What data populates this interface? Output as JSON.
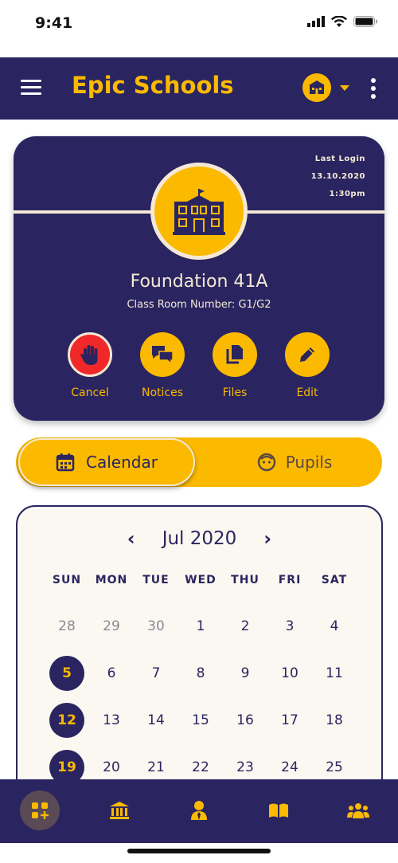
{
  "status": {
    "time": "9:41"
  },
  "header": {
    "app_name": "Epic Schools"
  },
  "class_card": {
    "last_login_label": "Last Login",
    "last_login_date": "13.10.2020",
    "last_login_time": "1:30pm",
    "class_name": "Foundation 41A",
    "room_number": "Class Room Number: G1/G2",
    "actions": [
      {
        "label": "Cancel",
        "icon": "stop-hand-icon"
      },
      {
        "label": "Notices",
        "icon": "chat-icon"
      },
      {
        "label": "Files",
        "icon": "files-icon"
      },
      {
        "label": "Edit",
        "icon": "pencil-icon"
      }
    ]
  },
  "tabs": {
    "calendar": "Calendar",
    "pupils": "Pupils",
    "active": "calendar"
  },
  "calendar": {
    "month_title": "Jul 2020",
    "weekdays": [
      "SUN",
      "MON",
      "TUE",
      "WED",
      "THU",
      "FRI",
      "SAT"
    ],
    "weeks": [
      [
        "28",
        "29",
        "30",
        "1",
        "2",
        "3",
        "4"
      ],
      [
        "5",
        "6",
        "7",
        "8",
        "9",
        "10",
        "11"
      ],
      [
        "12",
        "13",
        "14",
        "15",
        "16",
        "17",
        "18"
      ],
      [
        "19",
        "20",
        "21",
        "22",
        "23",
        "24",
        "25"
      ]
    ],
    "other_month_days": [
      "28",
      "29",
      "30"
    ],
    "selected_days": [
      "5",
      "12",
      "19"
    ]
  },
  "bottom_nav": [
    "dashboard-icon",
    "school-building-icon",
    "person-icon",
    "book-icon",
    "group-icon"
  ],
  "colors": {
    "navy": "#2a2560",
    "yellow": "#fbb900",
    "cream": "#f5e9d6",
    "red": "#f0282a"
  }
}
